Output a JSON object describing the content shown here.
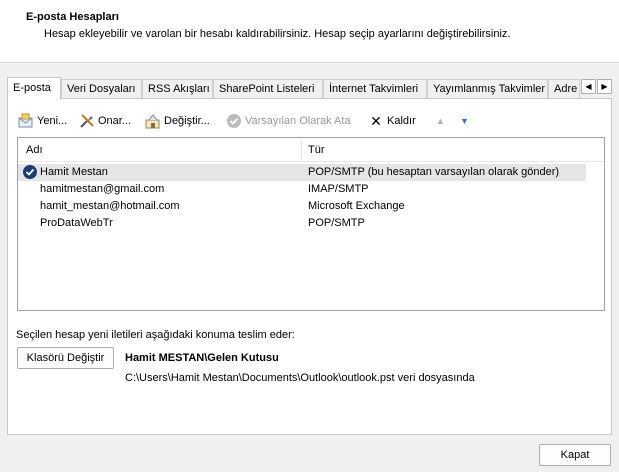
{
  "header": {
    "title": "E-posta Hesapları",
    "description": "Hesap ekleyebilir ve varolan bir hesabı kaldırabilirsiniz. Hesap seçip ayarlarını değiştirebilirsiniz."
  },
  "tabs": [
    {
      "label": "E-posta",
      "active": true
    },
    {
      "label": "Veri Dosyaları"
    },
    {
      "label": "RSS Akışları"
    },
    {
      "label": "SharePoint Listeleri"
    },
    {
      "label": "İnternet Takvimleri"
    },
    {
      "label": "Yayımlanmış Takvimler"
    },
    {
      "label": "Adre"
    }
  ],
  "tab_scroll": {
    "left": "◀",
    "right": "▶"
  },
  "toolbar": {
    "new_label": "Yeni...",
    "repair_label": "Onar...",
    "change_label": "Değiştir...",
    "set_default_label": "Varsayılan Olarak Ata",
    "remove_label": "Kaldır",
    "remove_glyph": "✕",
    "up_glyph": "▲",
    "down_glyph": "▼"
  },
  "list": {
    "columns": {
      "name": "Adı",
      "type": "Tür"
    },
    "rows": [
      {
        "name": "Hamit Mestan",
        "type": "POP/SMTP (bu hesaptan varsayılan olarak gönder)",
        "default": true
      },
      {
        "name": "hamitmestan@gmail.com",
        "type": "IMAP/SMTP"
      },
      {
        "name": "hamit_mestan@hotmail.com",
        "type": "Microsoft Exchange"
      },
      {
        "name": "ProDataWebTr",
        "type": "POP/SMTP"
      }
    ],
    "check_glyph": "✓"
  },
  "delivery": {
    "label": "Seçilen hesap yeni iletileri aşağıdaki konuma teslim eder:",
    "change_folder_label": "Klasörü Değiştir",
    "folder_name": "Hamit MESTAN\\Gelen Kutusu",
    "folder_path": "C:\\Users\\Hamit Mestan\\Documents\\Outlook\\outlook.pst veri dosyasında"
  },
  "close_label": "Kapat",
  "colors": {
    "accent": "#1c3d73",
    "arrow_down": "#2f6fd6",
    "disabled": "#9a9a9a"
  }
}
